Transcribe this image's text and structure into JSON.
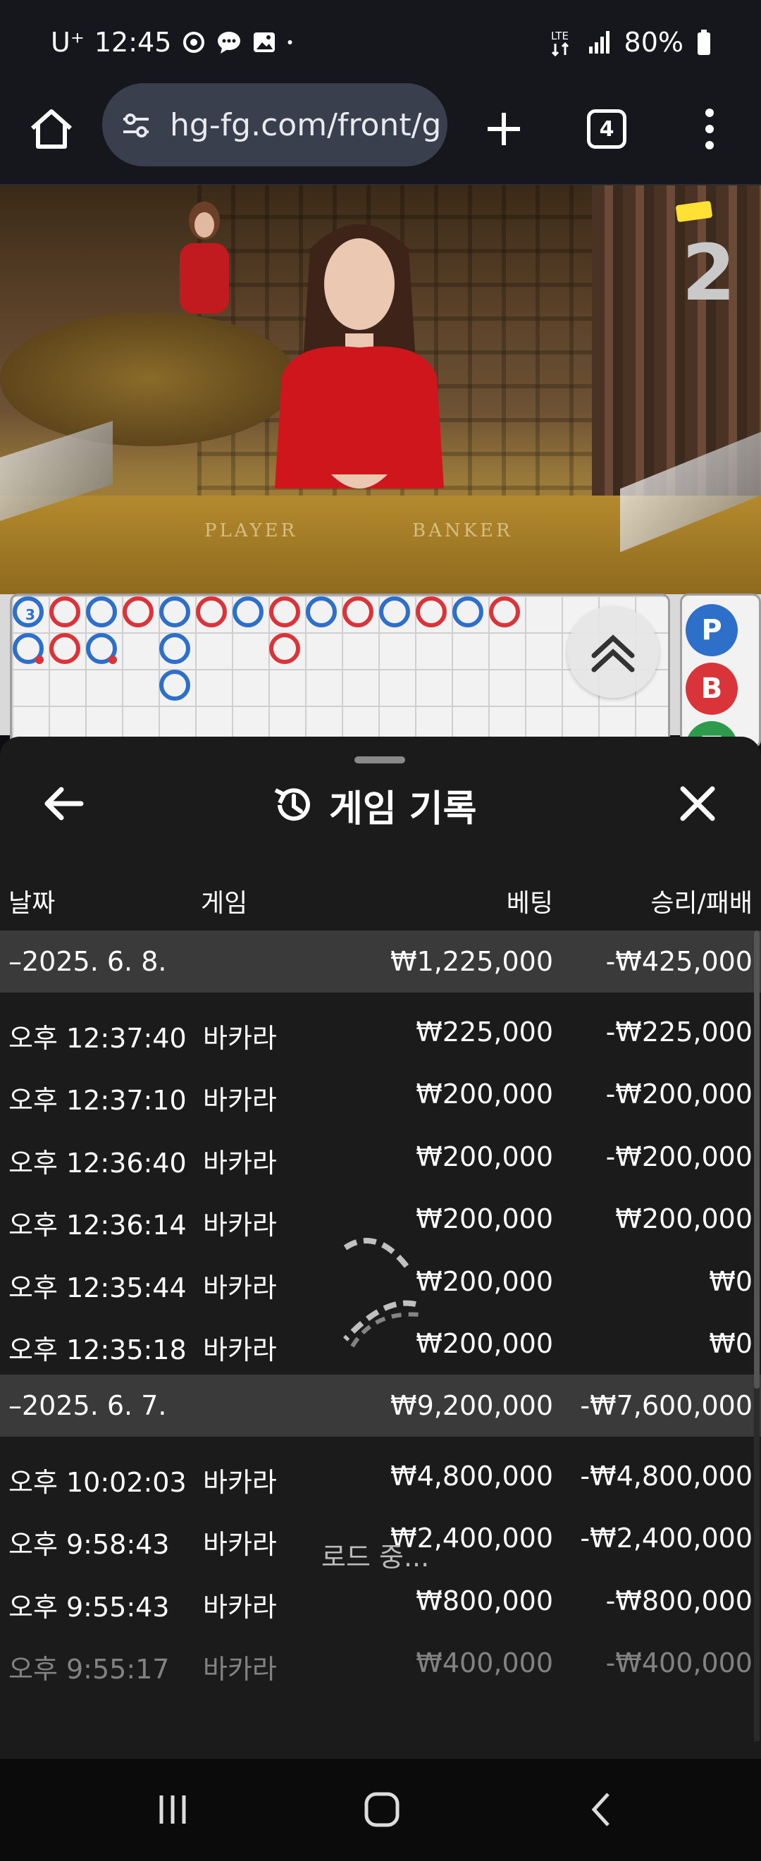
{
  "status_bar": {
    "carrier": "U⁺",
    "time": "12:45",
    "network": "LTE",
    "battery": "80%"
  },
  "browser": {
    "url": "hg-fg.com/front/g",
    "tab_count": "4"
  },
  "video": {
    "player_label": "PLAYER",
    "banker_label": "BANKER",
    "shoe_number": "2"
  },
  "roadmap": {
    "first_bead_label": "3",
    "bet_buttons": [
      "P",
      "B",
      "T"
    ]
  },
  "sheet": {
    "title": "게임 기록",
    "columns": {
      "date": "날짜",
      "game": "게임",
      "bet": "베팅",
      "win_loss": "승리/패배"
    },
    "groups": [
      {
        "date": "–2025. 6. 8.",
        "bet_total": "₩1,225,000",
        "win_loss_total": "-₩425,000",
        "rows": [
          {
            "time": "오후 12:37:40",
            "game": "바카라",
            "bet": "₩225,000",
            "result": "-₩225,000"
          },
          {
            "time": "오후 12:37:10",
            "game": "바카라",
            "bet": "₩200,000",
            "result": "-₩200,000"
          },
          {
            "time": "오후 12:36:40",
            "game": "바카라",
            "bet": "₩200,000",
            "result": "-₩200,000"
          },
          {
            "time": "오후 12:36:14",
            "game": "바카라",
            "bet": "₩200,000",
            "result": "₩200,000"
          },
          {
            "time": "오후 12:35:44",
            "game": "바카라",
            "bet": "₩200,000",
            "result": "₩0"
          },
          {
            "time": "오후 12:35:18",
            "game": "바카라",
            "bet": "₩200,000",
            "result": "₩0"
          }
        ]
      },
      {
        "date": "–2025. 6. 7.",
        "loading_text": "로드 중...",
        "bet_total": "₩9,200,000",
        "win_loss_total": "-₩7,600,000",
        "rows": [
          {
            "time": "오후 10:02:03",
            "game": "바카라",
            "bet": "₩4,800,000",
            "result": "-₩4,800,000"
          },
          {
            "time": "오후 9:58:43",
            "game": "바카라",
            "bet": "₩2,400,000",
            "result": "-₩2,400,000"
          },
          {
            "time": "오후 9:55:43",
            "game": "바카라",
            "bet": "₩800,000",
            "result": "-₩800,000"
          },
          {
            "time": "오후 9:55:17",
            "game": "바카라",
            "bet": "₩400,000",
            "result": "-₩400,000"
          }
        ]
      }
    ]
  },
  "colors": {
    "sheet_bg": "#1b1b1b",
    "date_row_bg": "#3a3a3a",
    "banker_red": "#d9343a",
    "player_blue": "#2d6fc9"
  }
}
